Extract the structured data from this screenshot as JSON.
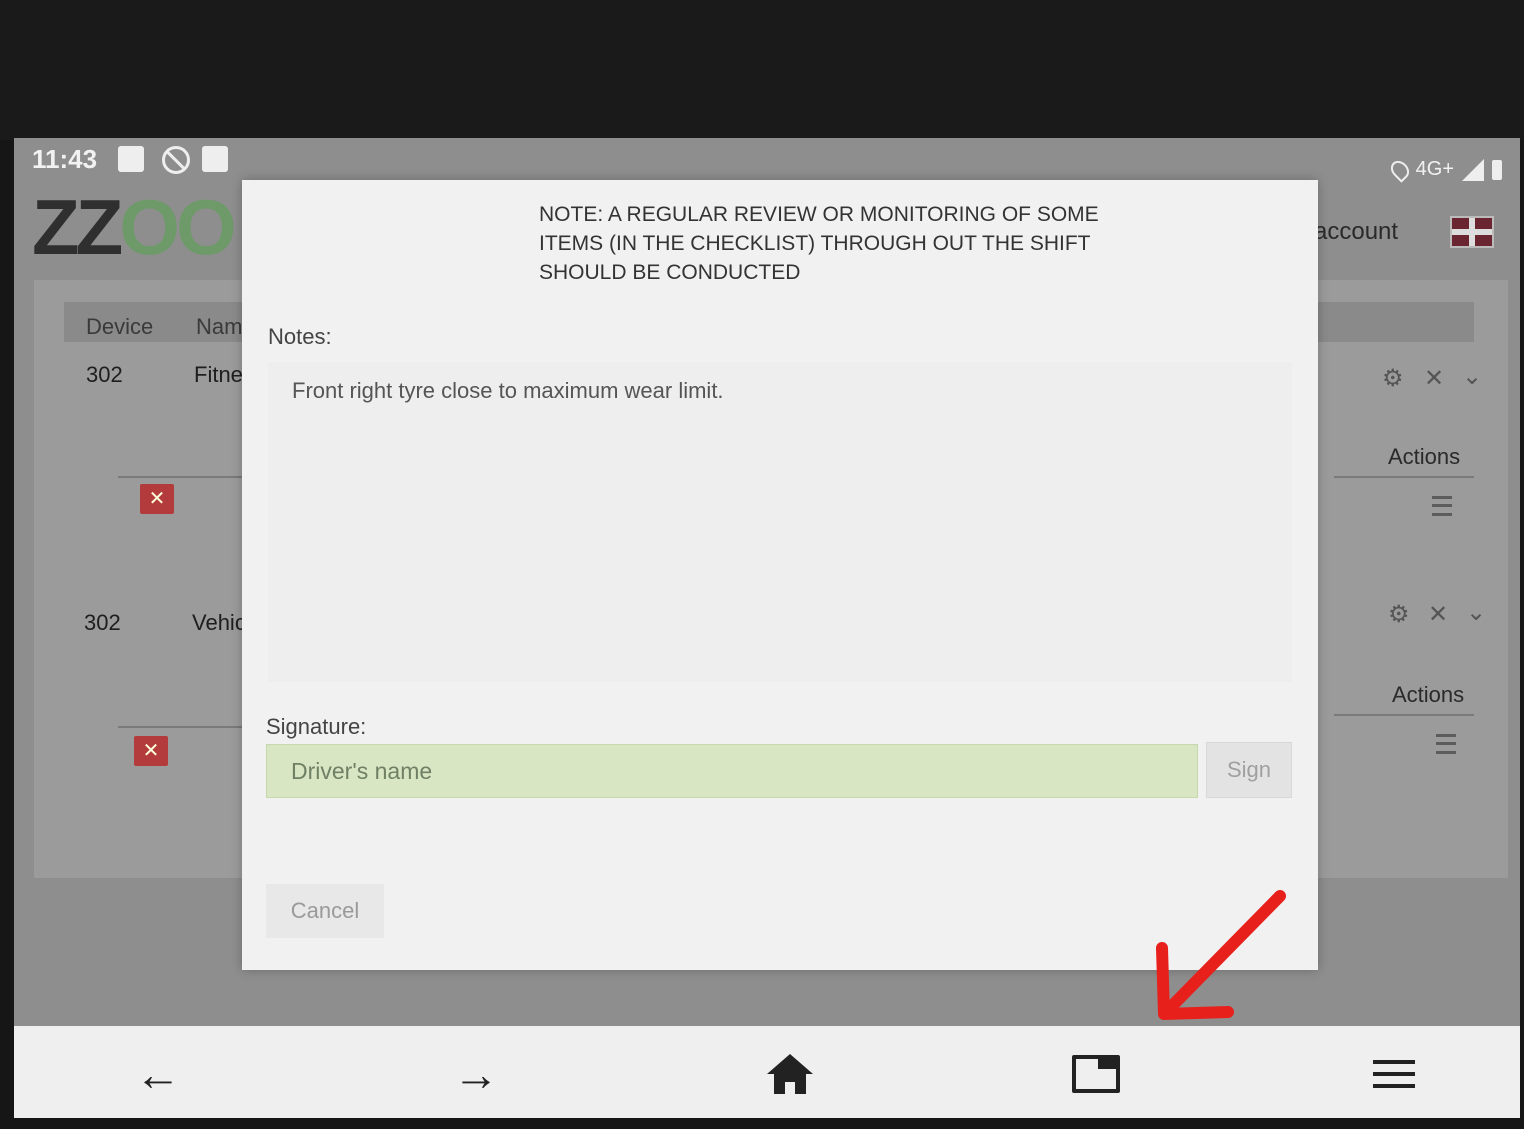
{
  "status_bar": {
    "time": "11:43",
    "network": "4G+"
  },
  "app": {
    "logo_text_dark": "ZZ",
    "logo_text_green": "OO",
    "account_link": "account"
  },
  "table": {
    "headers": [
      "Device",
      "Name"
    ],
    "rows": [
      {
        "device": "302",
        "name": "Fitnes",
        "actions_label": "Actions"
      },
      {
        "device": "302",
        "name": "Vehicl",
        "actions_label": "Actions"
      }
    ]
  },
  "modal": {
    "note": "NOTE:  A REGULAR REVIEW OR MONITORING OF SOME ITEMS  (IN THE CHECKLIST) THROUGH OUT THE SHIFT SHOULD BE CONDUCTED",
    "notes_label": "Notes:",
    "notes_value": "Front right tyre close to maximum wear limit.",
    "signature_label": "Signature:",
    "signature_placeholder": "Driver's name",
    "sign_button": "Sign",
    "cancel_button": "Cancel"
  },
  "nav": {
    "back_glyph": "←",
    "forward_glyph": "→"
  },
  "icons": [
    "location-pin-icon",
    "signal-icon",
    "battery-icon",
    "flag-uk-icon",
    "gear-icon",
    "close-icon",
    "chevron-down-icon",
    "menu-icon",
    "back-arrow-icon",
    "forward-arrow-icon",
    "home-icon",
    "tabs-icon",
    "hamburger-icon"
  ],
  "colors": {
    "signature_field_bg": "#d8e6c3",
    "delete_button": "#b33b3b",
    "annotation_arrow": "#e8201c",
    "logo_green": "#6e9a6a"
  }
}
